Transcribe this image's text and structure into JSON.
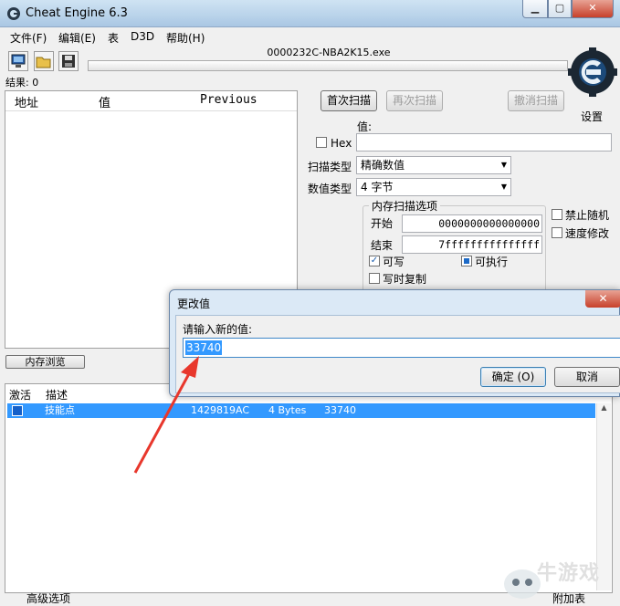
{
  "window": {
    "title": "Cheat Engine 6.3"
  },
  "menu": [
    "文件(F)",
    "编辑(E)",
    "表",
    "D3D",
    "帮助(H)"
  ],
  "process": {
    "name": "0000232C-NBA2K15.exe"
  },
  "results": {
    "label": "结果: 0"
  },
  "results_columns": {
    "address": "地址",
    "value": "值",
    "previous": "Previous"
  },
  "scan": {
    "first_label": "首次扫描",
    "next_label": "再次扫描",
    "undo_label": "撤消扫描",
    "settings_label": "设置",
    "value_label": "值:",
    "hex_label": "Hex",
    "scan_type_label": "扫描类型",
    "scan_type_value": "精确数值",
    "value_type_label": "数值类型",
    "value_type_value": "4 字节"
  },
  "memory_options": {
    "title": "内存扫描选项",
    "start_label": "开始",
    "start_value": "0000000000000000",
    "end_label": "结束",
    "end_value": "7fffffffffffffff",
    "writable_label": "可写",
    "executable_label": "可执行",
    "copy_on_write_label": "写时复制",
    "disable_random_label": "禁止随机",
    "speedhack_label": "速度修改"
  },
  "memory_view_button": "内存浏览",
  "address_table": {
    "columns": {
      "active": "激活",
      "description": "描述"
    },
    "rows": [
      {
        "description": "技能点",
        "address": "1429819AC",
        "type": "4 Bytes",
        "value": "33740"
      }
    ]
  },
  "footer": {
    "advanced": "高级选项",
    "add_table": "附加表"
  },
  "dialog": {
    "title": "更改值",
    "prompt": "请输入新的值:",
    "value": "33740",
    "ok_label": "确定 (O)",
    "cancel_label": "取消",
    "close_symbol": "✕"
  },
  "watermark": {
    "text": "牛游戏"
  }
}
